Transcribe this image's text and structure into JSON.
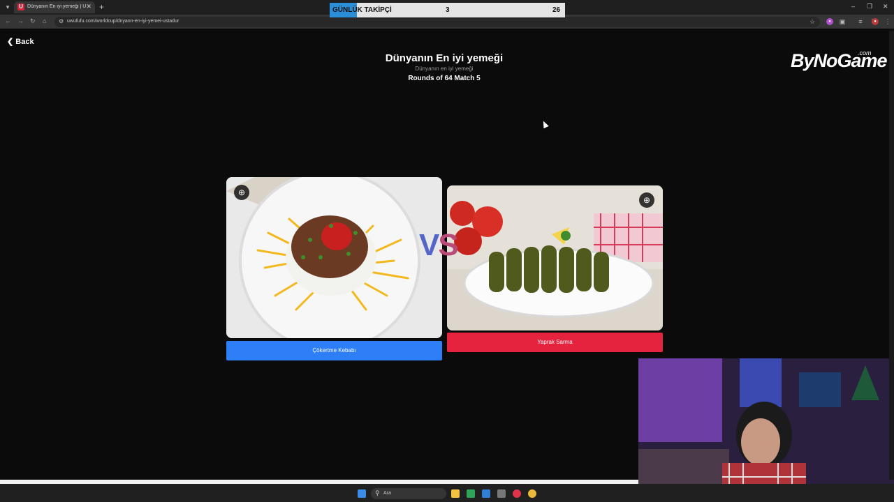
{
  "browser": {
    "tab_title": "Dünyanın En iyi yemeği | UwUf",
    "tab_favicon": "U",
    "url": "uwufufu.com/worldcup/dnyann-en-iyi-yemei-ustadur"
  },
  "overlay": {
    "label": "GÜNLÜK TAKİPÇİ",
    "count_current": "3",
    "count_goal": "26",
    "progress_fraction": 0.115
  },
  "page": {
    "back_label": "Back",
    "title": "Dünyanın En iyi yemeği",
    "subtitle": "Dünyanın en iyi yemeği",
    "round": "Rounds of 64 Match 5",
    "logo_text": "ByNoGame",
    "logo_sup": ".com",
    "vs_label": "VS"
  },
  "choices": [
    {
      "label": "Çökertme Kebabı",
      "color": "#2d7ef7"
    },
    {
      "label": "Yaprak Sarma",
      "color": "#e5233f"
    }
  ],
  "taskbar": {
    "search_placeholder": "Ara"
  }
}
